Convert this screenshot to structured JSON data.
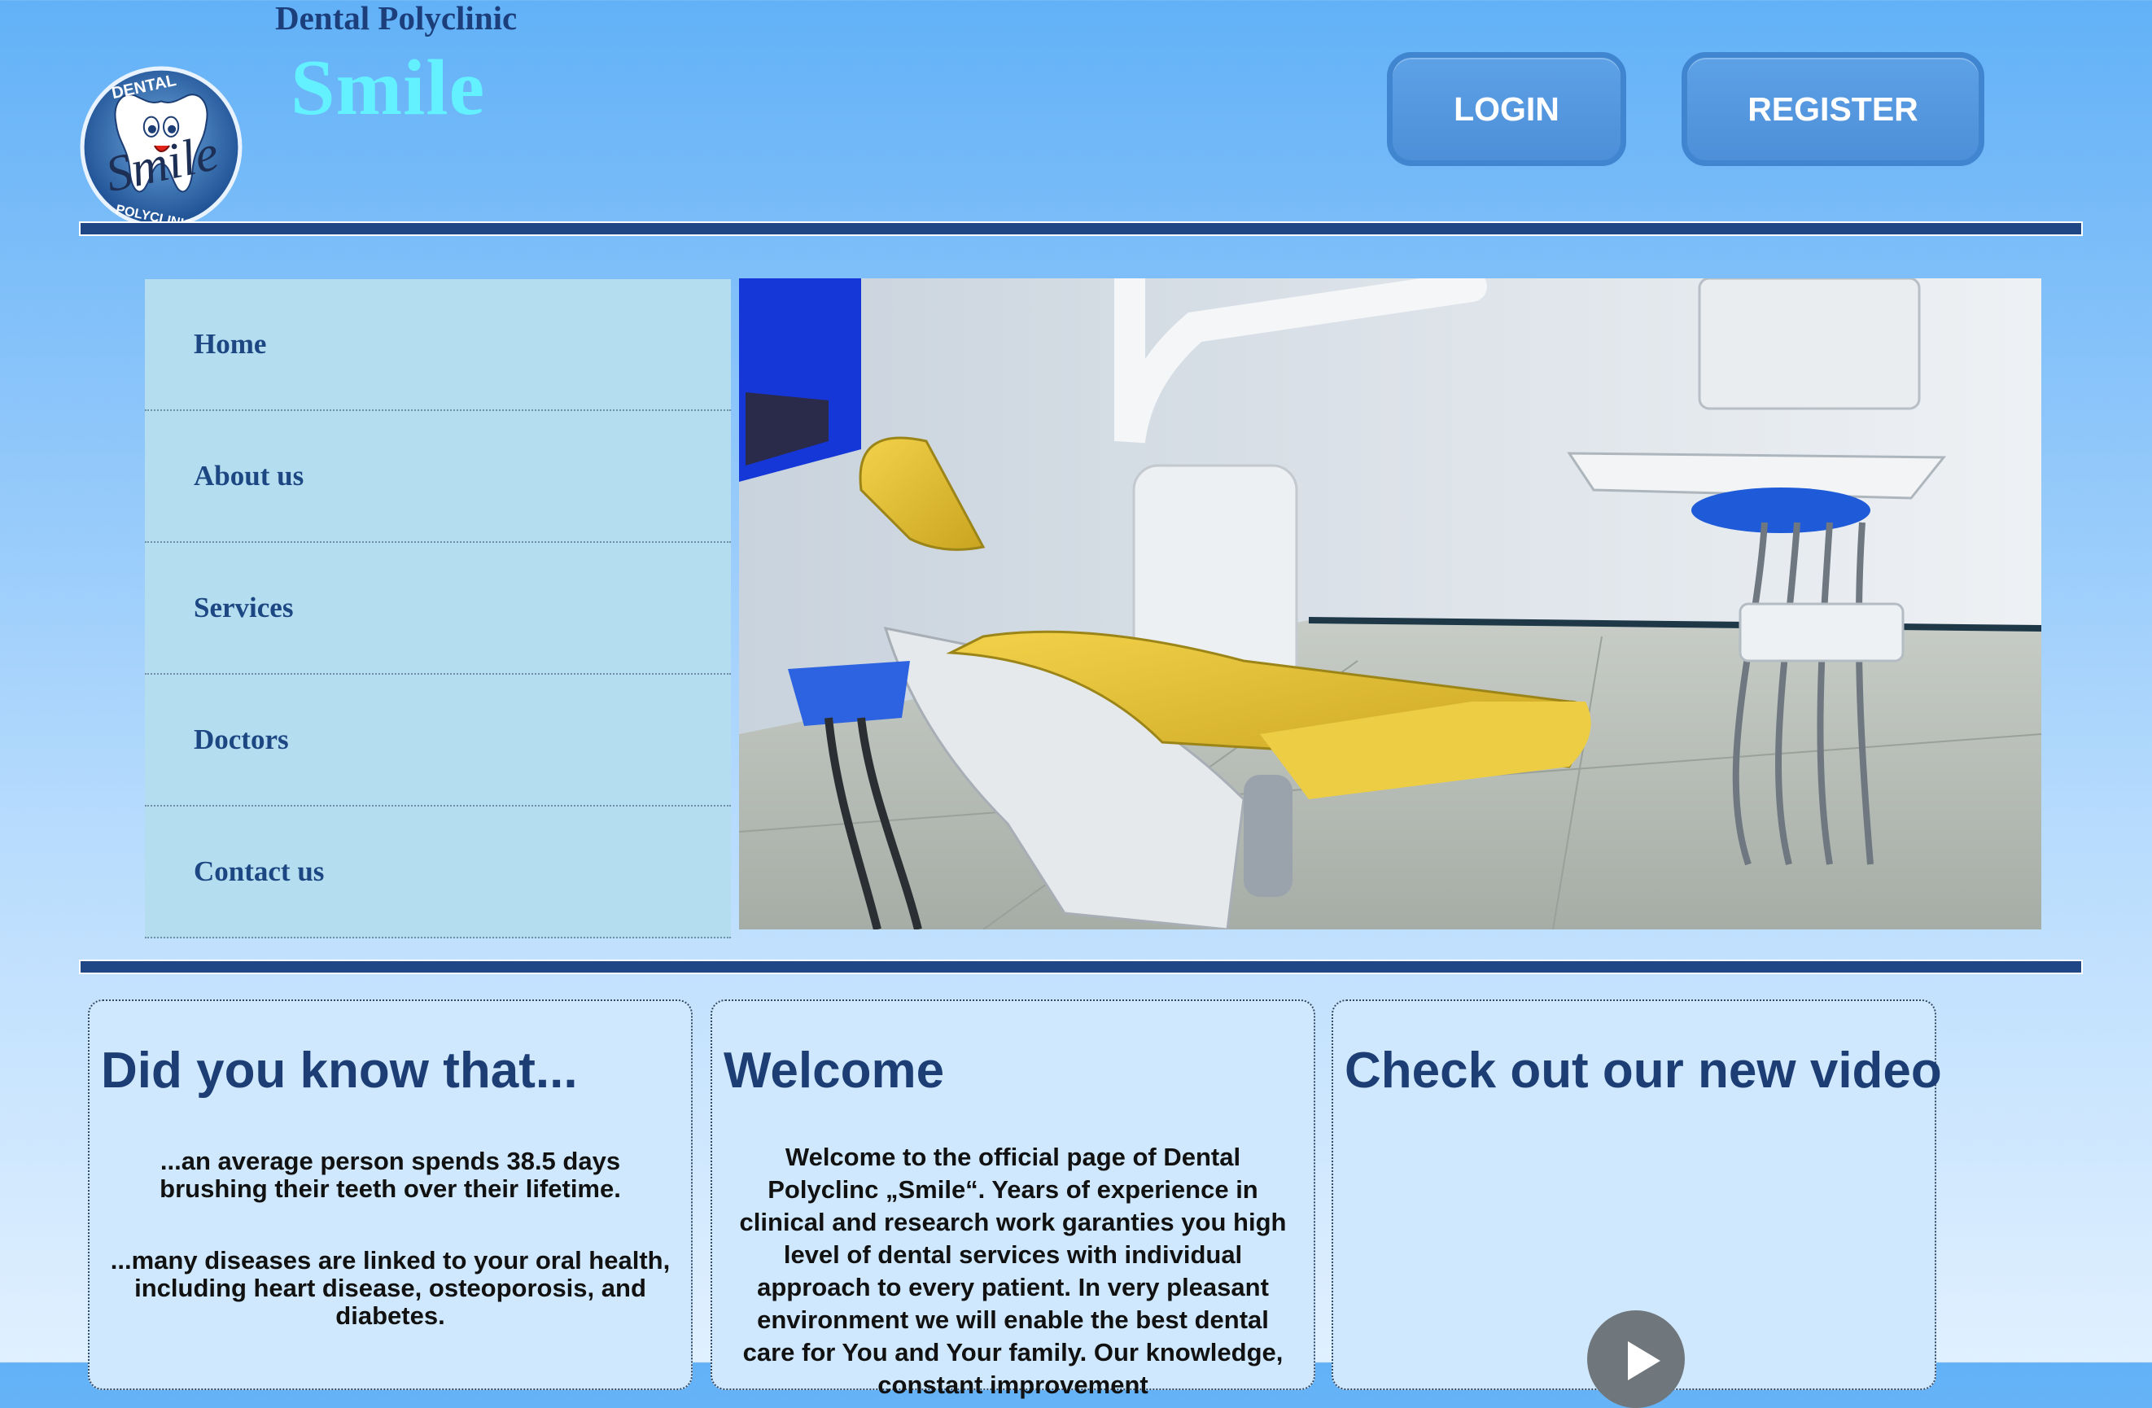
{
  "header": {
    "brand_top": "Dental Polyclinic",
    "brand_main": "Smile",
    "logo": {
      "ring_text_top": "DENTAL",
      "script_text": "Smile",
      "ring_text_bottom": "POLYCLINIC"
    },
    "login_label": "LOGIN",
    "register_label": "REGISTER"
  },
  "nav": {
    "items": [
      {
        "label": "Home"
      },
      {
        "label": "About us"
      },
      {
        "label": "Services"
      },
      {
        "label": "Doctors"
      },
      {
        "label": "Contact us"
      }
    ]
  },
  "sections": {
    "facts": {
      "title": "Did you know that...",
      "items": [
        "...an average person spends 38.5 days brushing their teeth over their lifetime.",
        "...many diseases are linked to your oral health, including heart disease, osteoporosis, and diabetes."
      ]
    },
    "welcome": {
      "title": "Welcome",
      "text": "Welcome to the official page of Dental Polyclinc „Smile“. Years of experience in clinical and research work garanties you high level of dental services with individual approach to every patient. In very pleasant environment we will enable the best dental care for You and Your family. Our knowledge, constant improvement"
    },
    "video": {
      "title": "Check out our new video",
      "play_icon": "play-icon"
    }
  },
  "colors": {
    "brand_dark": "#1d3e75",
    "brand_accent": "#63f0ff",
    "button_blue": "#4d8fd8",
    "nav_bg": "#b4def0",
    "rule": "#1f4786"
  }
}
